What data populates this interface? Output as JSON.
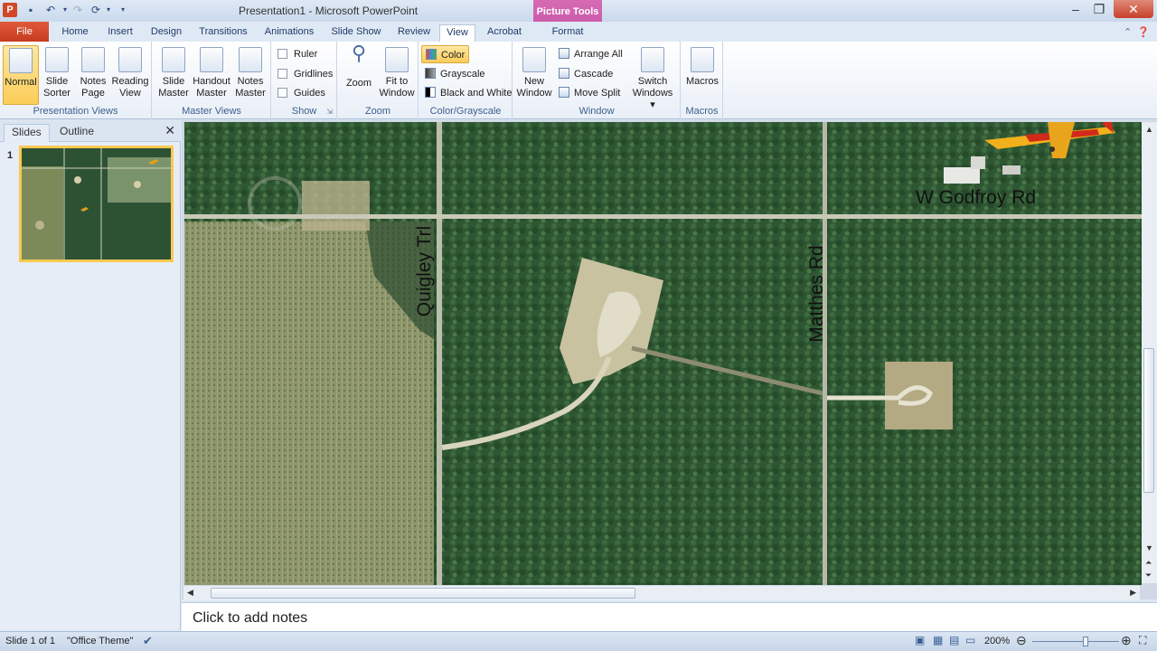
{
  "window": {
    "title": "Presentation1 - Microsoft PowerPoint",
    "context_tab_group": "Picture Tools"
  },
  "tabs": [
    "File",
    "Home",
    "Insert",
    "Design",
    "Transitions",
    "Animations",
    "Slide Show",
    "Review",
    "View",
    "Acrobat",
    "Format"
  ],
  "active_tab": "View",
  "ribbon": {
    "presentation_views": {
      "label": "Presentation Views",
      "normal": "Normal",
      "slide_sorter": [
        "Slide",
        "Sorter"
      ],
      "notes_page": [
        "Notes",
        "Page"
      ],
      "reading_view": [
        "Reading",
        "View"
      ]
    },
    "master_views": {
      "label": "Master Views",
      "slide_master": [
        "Slide",
        "Master"
      ],
      "handout_master": [
        "Handout",
        "Master"
      ],
      "notes_master": [
        "Notes",
        "Master"
      ]
    },
    "show": {
      "label": "Show",
      "ruler": "Ruler",
      "gridlines": "Gridlines",
      "guides": "Guides"
    },
    "zoom": {
      "label": "Zoom",
      "zoom": "Zoom",
      "fit_to_window": [
        "Fit to",
        "Window"
      ]
    },
    "color_grayscale": {
      "label": "Color/Grayscale",
      "color": "Color",
      "grayscale": "Grayscale",
      "black_and_white": "Black and White"
    },
    "window": {
      "label": "Window",
      "new_window": [
        "New",
        "Window"
      ],
      "arrange_all": "Arrange All",
      "cascade": "Cascade",
      "move_split": "Move Split",
      "switch_windows": [
        "Switch",
        "Windows ▾"
      ]
    },
    "macros": {
      "label": "Macros",
      "macros": "Macros"
    }
  },
  "left_panel": {
    "tab_slides": "Slides",
    "tab_outline": "Outline",
    "slide_number": "1"
  },
  "map_labels": {
    "quigley": "Quigley Trl",
    "matthes": "Matthes Rd",
    "godfroy": "W Godfroy Rd"
  },
  "notes": {
    "placeholder": "Click to add notes"
  },
  "status": {
    "slide_info": "Slide 1 of 1",
    "theme": "\"Office Theme\"",
    "zoom": "200%"
  },
  "colors": {
    "accent_file": "#c9401f",
    "context_tab": "#c34ea2",
    "selected": "#fbcd58"
  }
}
